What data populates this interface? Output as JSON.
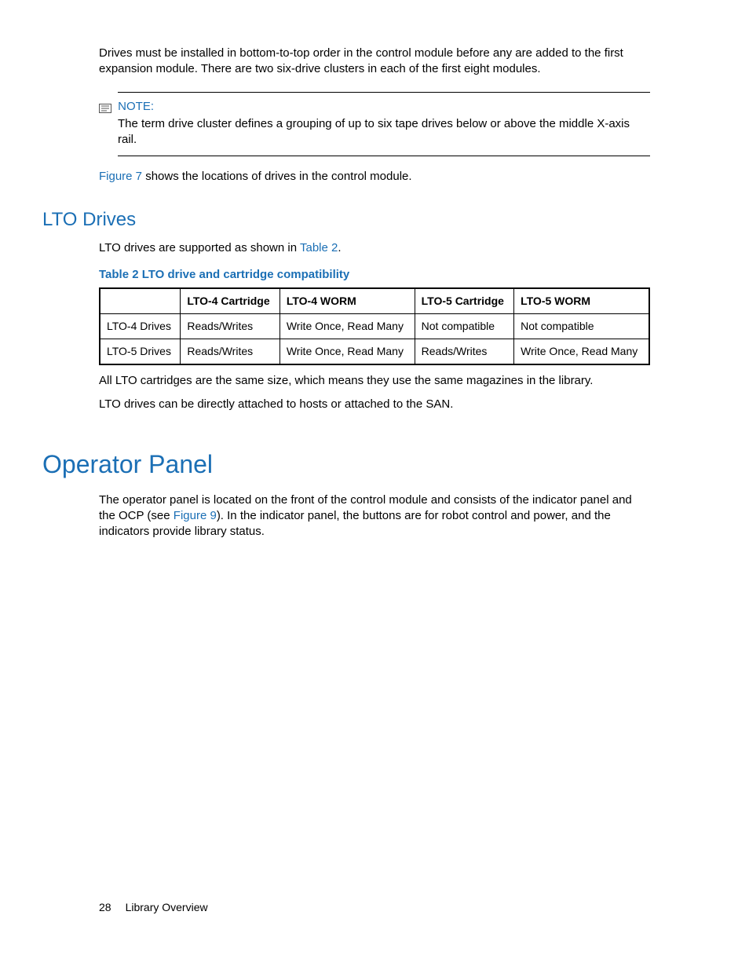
{
  "intro_para": "Drives must be installed in bottom-to-top order in the control module before any are added to the first expansion module. There are two six-drive clusters in each of the first eight modules.",
  "note": {
    "label": "NOTE:",
    "body": "The term drive cluster defines a grouping of up to six tape drives below or above the middle X-axis rail."
  },
  "fig7_sentence_pre": "",
  "fig7_link": "Figure 7",
  "fig7_sentence_post": " shows the locations of drives in the control module.",
  "lto_heading": "LTO Drives",
  "lto_para_pre": "LTO drives are supported as shown in ",
  "lto_para_link": "Table 2",
  "lto_para_post": ".",
  "table_caption": "Table 2 LTO drive and cartridge compatibility",
  "table": {
    "headers": [
      "",
      "LTO-4 Cartridge",
      "LTO-4 WORM",
      "LTO-5 Cartridge",
      "LTO-5 WORM"
    ],
    "rows": [
      [
        "LTO-4 Drives",
        "Reads/Writes",
        "Write Once, Read Many",
        "Not compatible",
        "Not compatible"
      ],
      [
        "LTO-5 Drives",
        "Reads/Writes",
        "Write Once, Read Many",
        "Reads/Writes",
        "Write Once, Read Many"
      ]
    ]
  },
  "after_table_p1": "All LTO cartridges are the same size, which means they use the same magazines in the library.",
  "after_table_p2": "LTO drives can be directly attached to hosts or attached to the SAN.",
  "op_heading": "Operator Panel",
  "op_para_pre": "The operator panel is located on the front of the control module and consists of the indicator panel and the OCP (see ",
  "op_para_link": "Figure 9",
  "op_para_post": "). In the indicator panel, the buttons are for robot control and power, and the indicators provide library status.",
  "footer": {
    "page_num": "28",
    "section": "Library Overview"
  }
}
